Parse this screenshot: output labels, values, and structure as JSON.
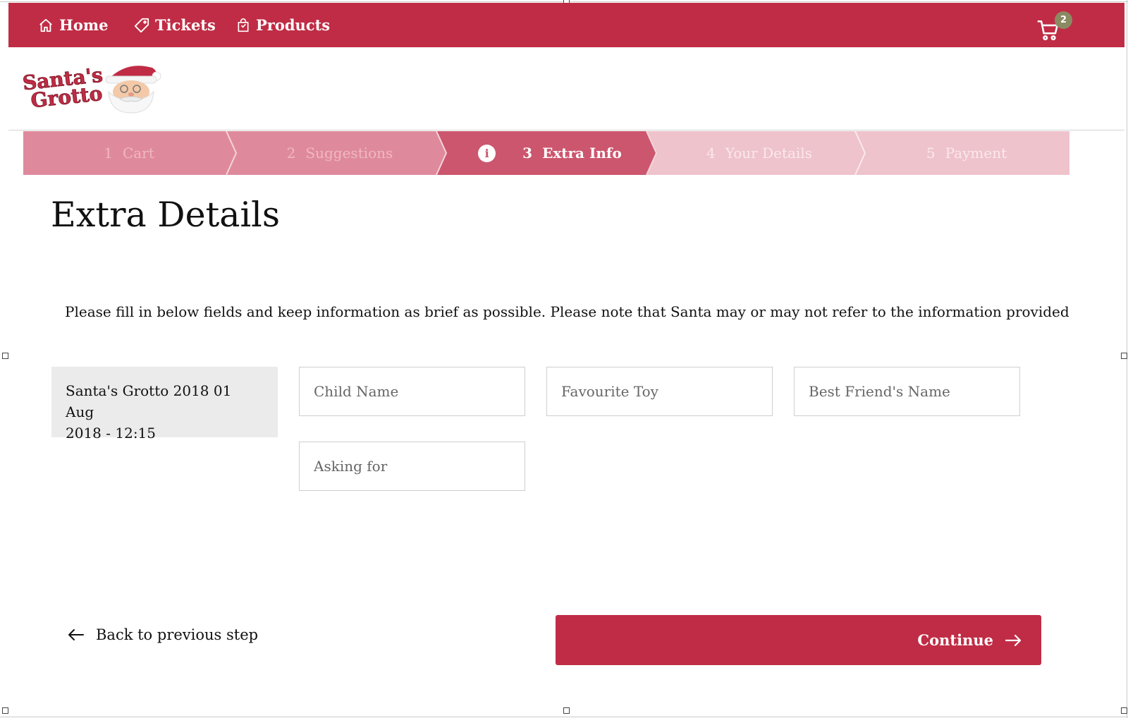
{
  "nav": {
    "items": [
      {
        "label": "Home",
        "icon": "home-icon"
      },
      {
        "label": "Tickets",
        "icon": "ticket-icon"
      },
      {
        "label": "Products",
        "icon": "shopping-bag-icon"
      }
    ],
    "cart_count": "2",
    "cart_icon": "cart-icon"
  },
  "logo": {
    "line1": "Santa's",
    "line2": "Grotto"
  },
  "steps": [
    {
      "num": "1",
      "label": "Cart",
      "state": "completed"
    },
    {
      "num": "2",
      "label": "Suggestions",
      "state": "completed"
    },
    {
      "num": "3",
      "label": "Extra Info",
      "state": "active",
      "icon": "info-icon",
      "icon_glyph": "i"
    },
    {
      "num": "4",
      "label": "Your Details",
      "state": "upcoming"
    },
    {
      "num": "5",
      "label": "Payment",
      "state": "upcoming"
    }
  ],
  "page": {
    "title": "Extra Details",
    "instructions": "Please fill in below fields and keep information as brief as possible. Please note that Santa may or may not refer to the information provided"
  },
  "booking": {
    "line1": "Santa's Grotto 2018 01 Aug",
    "line2": "2018 - 12:15"
  },
  "fields": {
    "child_name": {
      "placeholder": "Child Name",
      "value": ""
    },
    "favourite_toy": {
      "placeholder": "Favourite Toy",
      "value": ""
    },
    "best_friend": {
      "placeholder": "Best Friend's Name",
      "value": ""
    },
    "asking_for": {
      "placeholder": "Asking for",
      "value": ""
    }
  },
  "actions": {
    "back_label": "Back to previous step",
    "continue_label": "Continue"
  },
  "colors": {
    "brand_red": "#c02c45",
    "step_completed": "#df8a9c",
    "step_active": "#cc566e",
    "step_upcoming": "#eec3cc",
    "badge": "#8c8a63"
  }
}
